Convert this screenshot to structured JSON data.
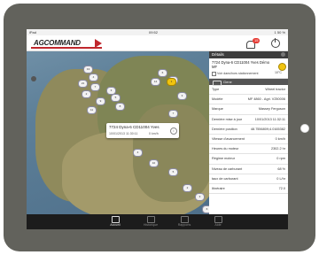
{
  "status": {
    "left": "iPad",
    "time": "09:52",
    "right": "1 50 %"
  },
  "header": {
    "logo": "AGCOMMAND",
    "notification_count": "15"
  },
  "map": {
    "pins": [
      "13",
      "4",
      "21",
      "7",
      "2",
      "9",
      "11",
      "3",
      "5",
      "8",
      "6",
      "14",
      "2",
      "3",
      "7",
      "1",
      "4",
      "10",
      "5",
      "2",
      "3",
      "6"
    ],
    "selected_pin": "1",
    "tooltip": {
      "title": "7724 Dyna-6 CD11004 Yves",
      "date": "10/01/2013 11:30:11",
      "speed": "0 km/h"
    }
  },
  "panel": {
    "header": "Détails",
    "vehicle_title": "7724 Dyna-6 CD11004 Yves Démo MF",
    "option_label": "Voir dans/hors stationnement",
    "temp": "10°C",
    "tab_label": "Gene",
    "details": [
      {
        "k": "Type",
        "v": "Wheel tractor"
      },
      {
        "k": "Modèle",
        "v": "MF 4860 - Agri. V250006"
      },
      {
        "k": "Marque",
        "v": "Massey Ferguson"
      },
      {
        "k": "Dernière mise à jour",
        "v": "10/01/2013 11:32:11"
      },
      {
        "k": "Dernière position",
        "v": "48.7556809;4.0165382"
      },
      {
        "k": "Vitesse d'avancement",
        "v": "0 km/h"
      },
      {
        "k": "Heures du moteur",
        "v": "2302.2 hr"
      },
      {
        "k": "Régime moteur",
        "v": "0 rpm"
      },
      {
        "k": "Niveau de carburant",
        "v": "68 %"
      },
      {
        "k": "taux de carburant",
        "v": "0 L/hr"
      },
      {
        "k": "Itinéraire",
        "v": "72.0"
      }
    ]
  },
  "bottom_tabs": [
    {
      "label": "Accueil",
      "icon": "home-icon"
    },
    {
      "label": "Historique",
      "icon": "history-icon"
    },
    {
      "label": "Rapports",
      "icon": "reports-icon"
    },
    {
      "label": "Aide",
      "icon": "help-icon"
    }
  ]
}
